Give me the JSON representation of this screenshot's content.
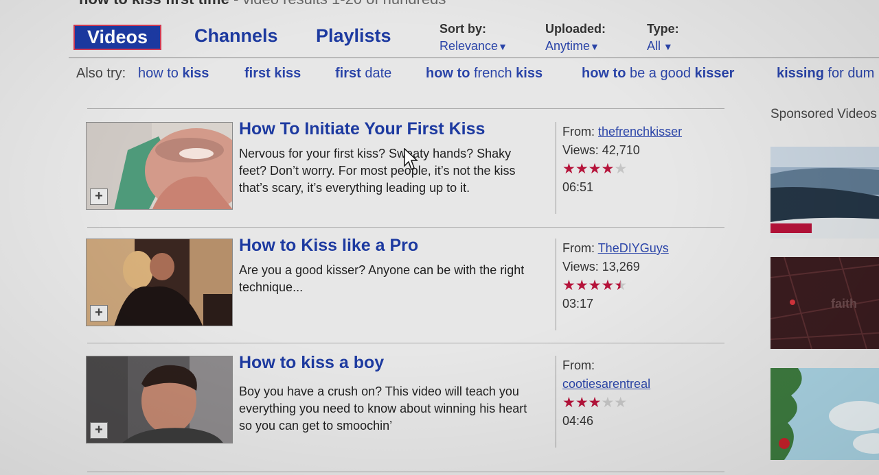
{
  "header": {
    "query_text": "how to kiss first time",
    "results_text": "- video results 1-20 of hundreds"
  },
  "tabs": [
    {
      "label": "Videos",
      "active": true
    },
    {
      "label": "Channels",
      "active": false
    },
    {
      "label": "Playlists",
      "active": false
    }
  ],
  "filters": {
    "sort": {
      "label": "Sort by:",
      "value": "Relevance"
    },
    "uploaded": {
      "label": "Uploaded:",
      "value": "Anytime"
    },
    "type": {
      "label": "Type:",
      "value": "All"
    }
  },
  "also_try": {
    "label": "Also try:",
    "terms": [
      "how to kiss",
      "first kiss",
      "first date",
      "how to french kiss",
      "how to be a good kisser",
      "kissing for dum"
    ]
  },
  "results": [
    {
      "title": "How To Initiate Your First Kiss",
      "description": "Nervous for your first kiss? Sweaty hands? Shaky feet? Don’t worry. For most people, it’s not the kiss that’s scary, it’s everything leading up to it.",
      "from_label": "From:",
      "channel": "thefrenchkisser",
      "views": "Views: 42,710",
      "rating": 4,
      "duration": "06:51"
    },
    {
      "title": "How to Kiss like a Pro",
      "description": "Are you a good kisser? Anyone can be with the right technique...",
      "from_label": "From:",
      "channel": "TheDIYGuys",
      "views": "Views: 13,269",
      "rating": 4.5,
      "duration": "03:17"
    },
    {
      "title": "How to kiss a boy",
      "description": "Boy you have a crush on? This video will teach you everything you need to know about winning his heart so you can get to smoochin’",
      "from_label": "From:",
      "channel": "cootiesarentreal",
      "views": "",
      "rating": 3,
      "duration": "04:46"
    }
  ],
  "sponsored": {
    "title": "Sponsored Videos",
    "ad2_text": "faith"
  },
  "icons": {
    "add": "plus-icon",
    "dropdown": "caret-down-icon",
    "star": "star-icon"
  },
  "colors": {
    "link": "#1d3aa0",
    "star": "#b5133a",
    "active_tab": "#1c3aa3"
  }
}
